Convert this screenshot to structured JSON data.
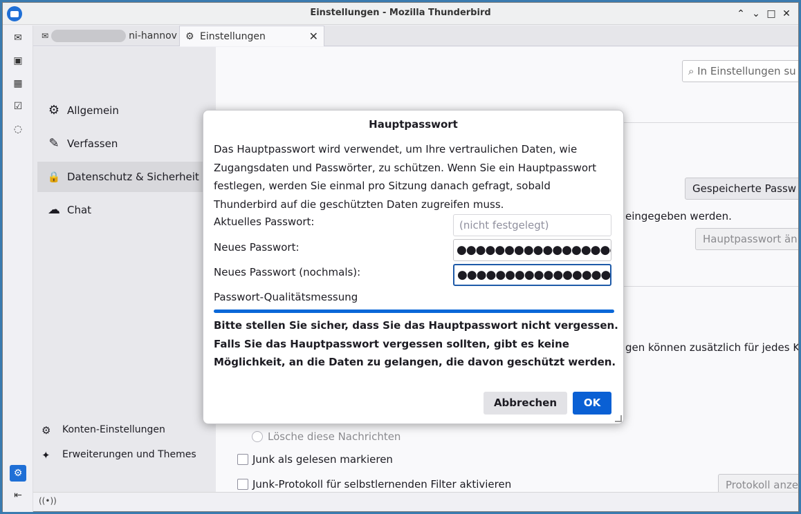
{
  "window": {
    "title": "Einstellungen - Mozilla Thunderbird"
  },
  "window_controls": {
    "minimize": "⌃",
    "restore": "⌄",
    "maximize": "□",
    "close": "✕"
  },
  "tabs": [
    {
      "label": "ni-hannov",
      "icon": "mail-icon",
      "redacted": true
    },
    {
      "label": "Einstellungen",
      "icon": "gear-icon"
    }
  ],
  "spaces": [
    {
      "name": "mail",
      "icon": "✉"
    },
    {
      "name": "address-book",
      "icon": "▣"
    },
    {
      "name": "calendar",
      "icon": "▦"
    },
    {
      "name": "tasks",
      "icon": "☑"
    },
    {
      "name": "chat",
      "icon": "◌"
    }
  ],
  "nav": {
    "items": [
      {
        "label": "Allgemein",
        "icon": "⚙"
      },
      {
        "label": "Verfassen",
        "icon": "✎"
      },
      {
        "label": "Datenschutz & Sicherheit",
        "icon": "🔒"
      },
      {
        "label": "Chat",
        "icon": "☁"
      }
    ],
    "footer": [
      {
        "label": "Konten-Einstellungen",
        "icon": "⚙"
      },
      {
        "label": "Erweiterungen und Themes",
        "icon": "✦"
      }
    ]
  },
  "content": {
    "search_placeholder": "⌕ In Einstellungen su",
    "saved_passwords_button": "Gespeicherte Passw",
    "text_entered": "eingegeben werden.",
    "change_master_button": "Hauptpasswort än",
    "text_additionally": "gen können zusätzlich für jedes Ko",
    "radio_delete": "Lösche diese Nachrichten",
    "checkbox_junk_read": "Junk als gelesen markieren",
    "checkbox_junk_log": "Junk-Protokoll für selbstlernenden Filter aktivieren",
    "protocol_button": "Protokoll anze"
  },
  "dialog": {
    "title": "Hauptpasswort",
    "description": "Das Hauptpasswort wird verwendet, um Ihre vertraulichen Daten, wie Zugangsdaten und Passwörter, zu schützen. Wenn Sie ein Hauptpasswort festlegen, werden Sie einmal pro Sitzung danach gefragt, sobald Thunderbird auf die geschützten Daten zugreifen muss.",
    "current_label": "Aktuelles Passwort:",
    "current_placeholder": "(nicht festgelegt)",
    "new_label": "Neues Passwort:",
    "new_value": "●●●●●●●●●●●●●●●●●●",
    "confirm_label": "Neues Passwort (nochmals):",
    "confirm_value": "●●●●●●●●●●●●●●●●●●",
    "quality_label": "Passwort-Qualitätsmessung",
    "quality_level": 1.0,
    "warning": "Bitte stellen Sie sicher, dass Sie das Hauptpasswort nicht vergessen. Falls Sie das Hauptpasswort vergessen sollten, gibt es keine Möglichkeit, an die Daten zu gelangen, die davon geschützt werden.",
    "cancel_label": "Abbrechen",
    "ok_label": "OK"
  },
  "status": {
    "icon": "((•))"
  },
  "colors": {
    "accent": "#0a60d4",
    "quality_bar": "#0a68d8",
    "desktop": "#3a7bb0"
  }
}
